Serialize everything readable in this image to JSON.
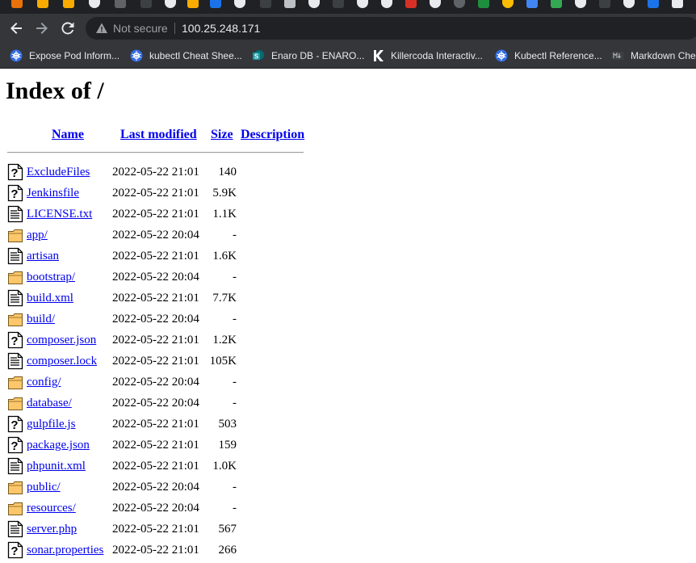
{
  "browser": {
    "security_label": "Not secure",
    "url": "100.25.248.171",
    "bookmarks": [
      {
        "label": "Expose Pod Inform...",
        "icon": "kubernetes-icon"
      },
      {
        "label": "kubectl Cheat Shee...",
        "icon": "kubernetes-icon"
      },
      {
        "label": "Enaro DB - ENARO...",
        "icon": "sharepoint-icon"
      },
      {
        "label": "Killercoda Interactiv...",
        "icon": "killercoda-icon"
      },
      {
        "label": "Kubectl Reference...",
        "icon": "kubernetes-icon"
      },
      {
        "label": "Markdown Che",
        "icon": "markdown-icon"
      }
    ]
  },
  "page": {
    "title": "Index of /",
    "headers": {
      "name": "Name",
      "modified": "Last modified",
      "size": "Size",
      "description": "Description"
    },
    "rows": [
      {
        "name": "ExcludeFiles",
        "modified": "2022-05-22 21:01",
        "size": "140",
        "icon": "unknown-file-icon"
      },
      {
        "name": "Jenkinsfile",
        "modified": "2022-05-22 21:01",
        "size": "5.9K",
        "icon": "unknown-file-icon"
      },
      {
        "name": "LICENSE.txt",
        "modified": "2022-05-22 21:01",
        "size": "1.1K",
        "icon": "text-file-icon"
      },
      {
        "name": "app/",
        "modified": "2022-05-22 20:04",
        "size": "-",
        "icon": "folder-icon"
      },
      {
        "name": "artisan",
        "modified": "2022-05-22 21:01",
        "size": "1.6K",
        "icon": "text-file-icon"
      },
      {
        "name": "bootstrap/",
        "modified": "2022-05-22 20:04",
        "size": "-",
        "icon": "folder-icon"
      },
      {
        "name": "build.xml",
        "modified": "2022-05-22 21:01",
        "size": "7.7K",
        "icon": "text-file-icon"
      },
      {
        "name": "build/",
        "modified": "2022-05-22 20:04",
        "size": "-",
        "icon": "folder-icon"
      },
      {
        "name": "composer.json",
        "modified": "2022-05-22 21:01",
        "size": "1.2K",
        "icon": "unknown-file-icon"
      },
      {
        "name": "composer.lock",
        "modified": "2022-05-22 21:01",
        "size": "105K",
        "icon": "text-file-icon"
      },
      {
        "name": "config/",
        "modified": "2022-05-22 20:04",
        "size": "-",
        "icon": "folder-icon"
      },
      {
        "name": "database/",
        "modified": "2022-05-22 20:04",
        "size": "-",
        "icon": "folder-icon"
      },
      {
        "name": "gulpfile.js",
        "modified": "2022-05-22 21:01",
        "size": "503",
        "icon": "unknown-file-icon"
      },
      {
        "name": "package.json",
        "modified": "2022-05-22 21:01",
        "size": "159",
        "icon": "unknown-file-icon"
      },
      {
        "name": "phpunit.xml",
        "modified": "2022-05-22 21:01",
        "size": "1.0K",
        "icon": "text-file-icon"
      },
      {
        "name": "public/",
        "modified": "2022-05-22 20:04",
        "size": "-",
        "icon": "folder-icon"
      },
      {
        "name": "resources/",
        "modified": "2022-05-22 20:04",
        "size": "-",
        "icon": "folder-icon"
      },
      {
        "name": "server.php",
        "modified": "2022-05-22 21:01",
        "size": "567",
        "icon": "text-file-icon"
      },
      {
        "name": "sonar.properties",
        "modified": "2022-05-22 21:01",
        "size": "266",
        "icon": "unknown-file-icon"
      }
    ]
  }
}
